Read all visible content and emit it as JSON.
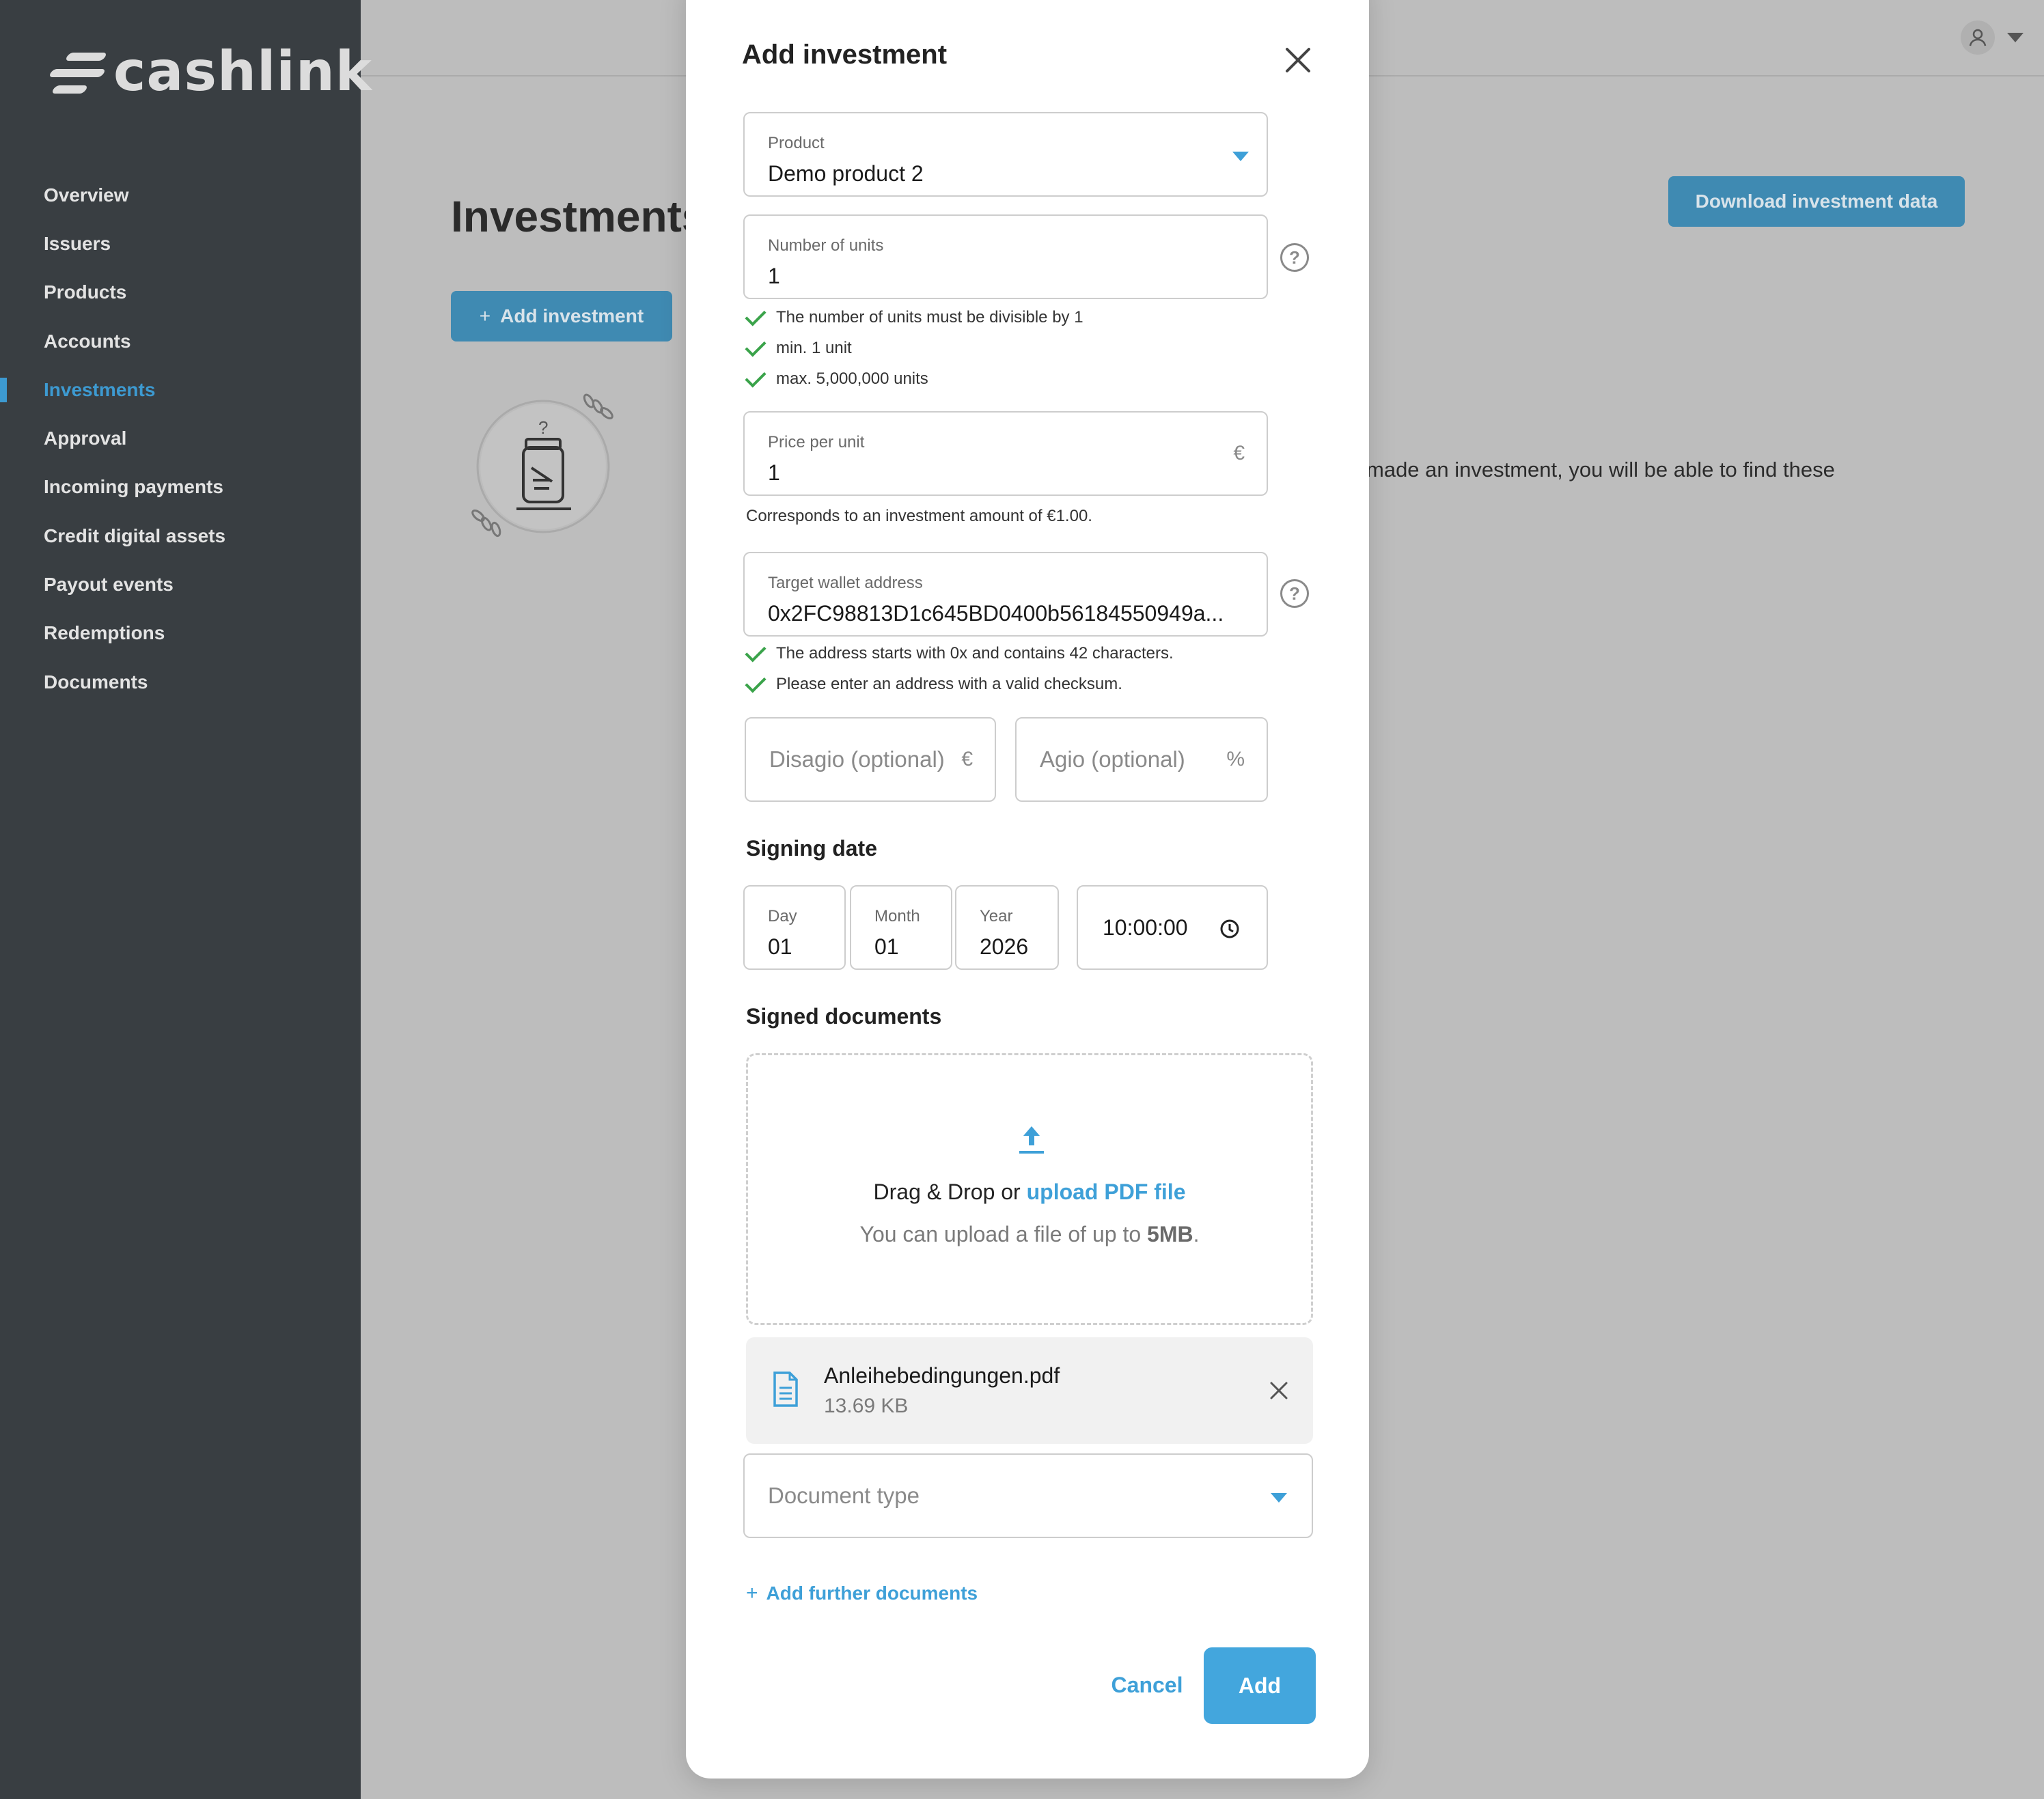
{
  "app": {
    "logo_text": "cashlink"
  },
  "sidebar": {
    "items": [
      {
        "label": "Overview"
      },
      {
        "label": "Issuers"
      },
      {
        "label": "Products"
      },
      {
        "label": "Accounts"
      },
      {
        "label": "Investments",
        "active": true
      },
      {
        "label": "Approval"
      },
      {
        "label": "Incoming payments"
      },
      {
        "label": "Credit digital assets"
      },
      {
        "label": "Payout events"
      },
      {
        "label": "Redemptions"
      },
      {
        "label": "Documents"
      }
    ]
  },
  "page": {
    "title": "Investments",
    "add_button": "Add investment",
    "download_button": "Download investment data",
    "empty_text": "made an investment, you will be able to find these"
  },
  "modal": {
    "title": "Add investment",
    "product": {
      "label": "Product",
      "value": "Demo product 2"
    },
    "units": {
      "label": "Number of units",
      "value": "1",
      "rules": [
        "The number of units must be divisible by 1",
        "min. 1 unit",
        "max. 5,000,000 units"
      ]
    },
    "price": {
      "label": "Price per unit",
      "value": "1",
      "suffix": "€",
      "hint": "Corresponds to an investment amount of €1.00."
    },
    "wallet": {
      "label": "Target wallet address",
      "value": "0x2FC98813D1c645BD0400b56184550949a...",
      "rules": [
        "The address starts with 0x and contains 42 characters.",
        "Please enter an address with a valid checksum."
      ]
    },
    "disagio": {
      "placeholder": "Disagio (optional)",
      "suffix": "€"
    },
    "agio": {
      "placeholder": "Agio (optional)",
      "suffix": "%"
    },
    "signing_date": {
      "title": "Signing date",
      "day": {
        "label": "Day",
        "value": "01"
      },
      "month": {
        "label": "Month",
        "value": "01"
      },
      "year": {
        "label": "Year",
        "value": "2026"
      },
      "time": "10:00:00"
    },
    "documents": {
      "title": "Signed documents",
      "drop_text": "Drag & Drop or",
      "upload_link": "upload PDF file",
      "limit_prefix": "You can upload a file of up to",
      "limit_value": "5MB",
      "limit_suffix": ".",
      "file": {
        "name": "Anleihebedingungen.pdf",
        "size": "13.69 KB"
      },
      "type_placeholder": "Document type",
      "add_more": "Add further documents"
    },
    "cancel": "Cancel",
    "submit": "Add"
  },
  "colors": {
    "accent": "#43a6dd",
    "sidebar": "#393e42",
    "success": "#3aa34a"
  }
}
